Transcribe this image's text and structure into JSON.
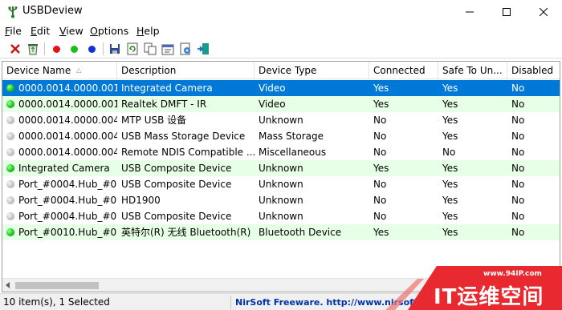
{
  "window": {
    "title": "USBDeview"
  },
  "menu": [
    {
      "label": "File",
      "u": "F",
      "rest": "ile"
    },
    {
      "label": "Edit",
      "u": "E",
      "rest": "dit"
    },
    {
      "label": "View",
      "u": "V",
      "rest": "iew"
    },
    {
      "label": "Options",
      "u": "O",
      "rest": "ptions"
    },
    {
      "label": "Help",
      "u": "H",
      "rest": "elp"
    }
  ],
  "columns": [
    "Device Name",
    "Description",
    "Device Type",
    "Connected",
    "Safe To Un...",
    "Disabled"
  ],
  "rows": [
    {
      "connected_led": true,
      "name": "0000.0014.0000.001....",
      "description": "Integrated Camera",
      "type": "Video",
      "connected": "Yes",
      "safe": "Yes",
      "disabled": "No",
      "state": "selected"
    },
    {
      "connected_led": true,
      "name": "0000.0014.0000.001....",
      "description": "Realtek DMFT - IR",
      "type": "Video",
      "connected": "Yes",
      "safe": "Yes",
      "disabled": "No",
      "state": "green"
    },
    {
      "connected_led": false,
      "name": "0000.0014.0000.004....",
      "description": "MTP USB 设备",
      "type": "Unknown",
      "connected": "No",
      "safe": "Yes",
      "disabled": "No",
      "state": "normal"
    },
    {
      "connected_led": false,
      "name": "0000.0014.0000.004....",
      "description": "USB Mass Storage Device",
      "type": "Mass Storage",
      "connected": "No",
      "safe": "Yes",
      "disabled": "No",
      "state": "normal"
    },
    {
      "connected_led": false,
      "name": "0000.0014.0000.004....",
      "description": "Remote NDIS Compatible ...",
      "type": "Miscellaneous",
      "connected": "No",
      "safe": "No",
      "disabled": "No",
      "state": "normal"
    },
    {
      "connected_led": true,
      "name": "Integrated Camera",
      "description": "USB Composite Device",
      "type": "Unknown",
      "connected": "Yes",
      "safe": "Yes",
      "disabled": "No",
      "state": "green"
    },
    {
      "connected_led": false,
      "name": "Port_#0004.Hub_#0...",
      "description": "USB Composite Device",
      "type": "Unknown",
      "connected": "No",
      "safe": "Yes",
      "disabled": "No",
      "state": "normal"
    },
    {
      "connected_led": false,
      "name": "Port_#0004.Hub_#0...",
      "description": "HD1900",
      "type": "Unknown",
      "connected": "No",
      "safe": "Yes",
      "disabled": "No",
      "state": "normal"
    },
    {
      "connected_led": false,
      "name": "Port_#0004.Hub_#0...",
      "description": "USB Composite Device",
      "type": "Unknown",
      "connected": "No",
      "safe": "Yes",
      "disabled": "No",
      "state": "normal"
    },
    {
      "connected_led": true,
      "name": "Port_#0010.Hub_#0...",
      "description": "英特尔(R) 无线 Bluetooth(R)",
      "type": "Bluetooth Device",
      "connected": "Yes",
      "safe": "Yes",
      "disabled": "No",
      "state": "green"
    }
  ],
  "status": {
    "count": "10 item(s), 1 Selected",
    "link": "NirSoft Freeware.  http://www.nirsoft.n"
  },
  "watermark": {
    "url": "www.94IP.com",
    "text": "IT运维空间"
  },
  "colors": {
    "selected": "#0078d7",
    "connected_row": "#e6ffe6",
    "watermark": "#e8292f"
  }
}
